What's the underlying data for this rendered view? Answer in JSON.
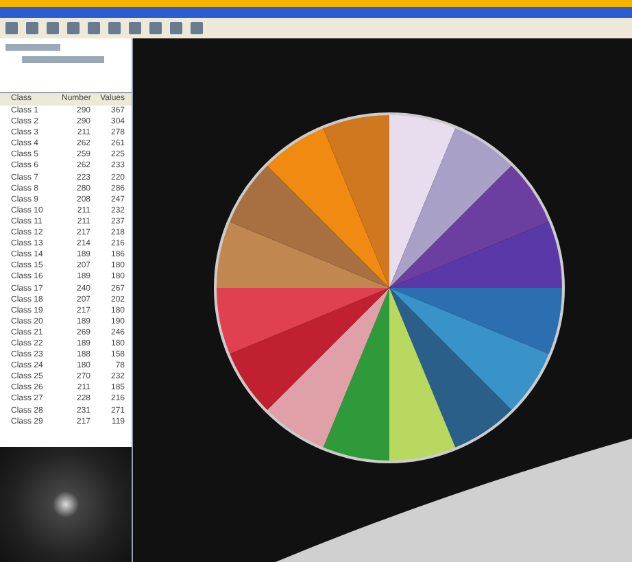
{
  "table": {
    "columns": [
      "Class",
      "Number",
      "Values"
    ],
    "rows": [
      [
        "Class 1",
        "290",
        "367"
      ],
      [
        "Class 2",
        "290",
        "304"
      ],
      [
        "Class 3",
        "211",
        "278"
      ],
      [
        "Class 4",
        "262",
        "261"
      ],
      [
        "Class 5",
        "259",
        "225"
      ],
      [
        "Class 6",
        "262",
        "233"
      ],
      [
        "Class 7",
        "223",
        "220"
      ],
      [
        "Class 8",
        "280",
        "286"
      ],
      [
        "Class 9",
        "208",
        "247"
      ],
      [
        "Class 10",
        "211",
        "232"
      ],
      [
        "Class 11",
        "211",
        "237"
      ],
      [
        "Class 12",
        "217",
        "218"
      ],
      [
        "Class 13",
        "214",
        "216"
      ],
      [
        "Class 14",
        "189",
        "186"
      ],
      [
        "Class 15",
        "207",
        "180"
      ],
      [
        "Class 16",
        "189",
        "180"
      ],
      [
        "Class 17",
        "240",
        "267"
      ],
      [
        "Class 18",
        "207",
        "202"
      ],
      [
        "Class 19",
        "217",
        "180"
      ],
      [
        "Class 20",
        "189",
        "190"
      ],
      [
        "Class 21",
        "269",
        "246"
      ],
      [
        "Class 22",
        "189",
        "180"
      ],
      [
        "Class 23",
        "188",
        "158"
      ],
      [
        "Class 24",
        "180",
        "78"
      ],
      [
        "Class 25",
        "270",
        "232"
      ],
      [
        "Class 26",
        "211",
        "185"
      ],
      [
        "Class 27",
        "228",
        "216"
      ],
      [
        "Class 28",
        "231",
        "271"
      ],
      [
        "Class 29",
        "217",
        "119"
      ]
    ]
  }
}
